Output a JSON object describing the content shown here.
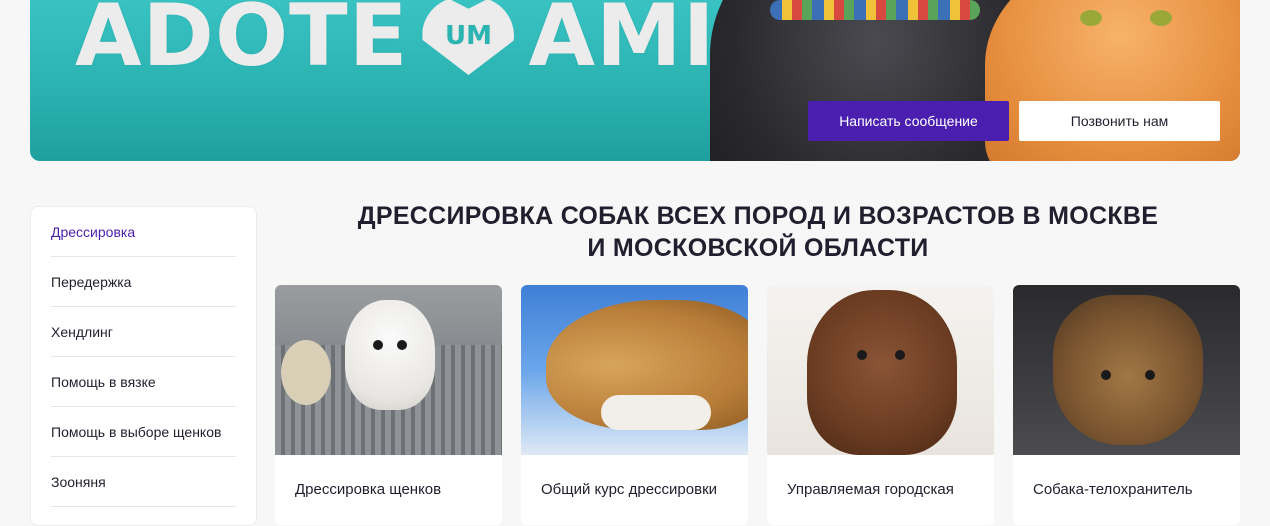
{
  "banner": {
    "logo_left": "ADOTE",
    "logo_heart": "UM",
    "logo_right": "AMIGO",
    "primary_button": "Написать сообщение",
    "secondary_button": "Позвонить нам"
  },
  "sidebar": {
    "items": [
      {
        "label": "Дрессировка",
        "active": true
      },
      {
        "label": "Передержка",
        "active": false
      },
      {
        "label": "Хендлинг",
        "active": false
      },
      {
        "label": "Помощь в вязке",
        "active": false
      },
      {
        "label": "Помощь в выборе щенков",
        "active": false
      },
      {
        "label": "Зооняня",
        "active": false
      }
    ]
  },
  "main": {
    "title_line1": "ДРЕССИРОВКА СОБАК ВСЕХ ПОРОД И ВОЗРАСТОВ В МОСКВЕ",
    "title_line2": "И МОСКОВСКОЙ ОБЛАСТИ",
    "cards": [
      {
        "title": "Дрессировка щенков"
      },
      {
        "title": "Общий курс дрессировки"
      },
      {
        "title": "Управляемая городская"
      },
      {
        "title": "Собака-телохранитель"
      }
    ]
  },
  "colors": {
    "accent": "#4a1fb0",
    "banner_teal": "#2cb4b3"
  }
}
